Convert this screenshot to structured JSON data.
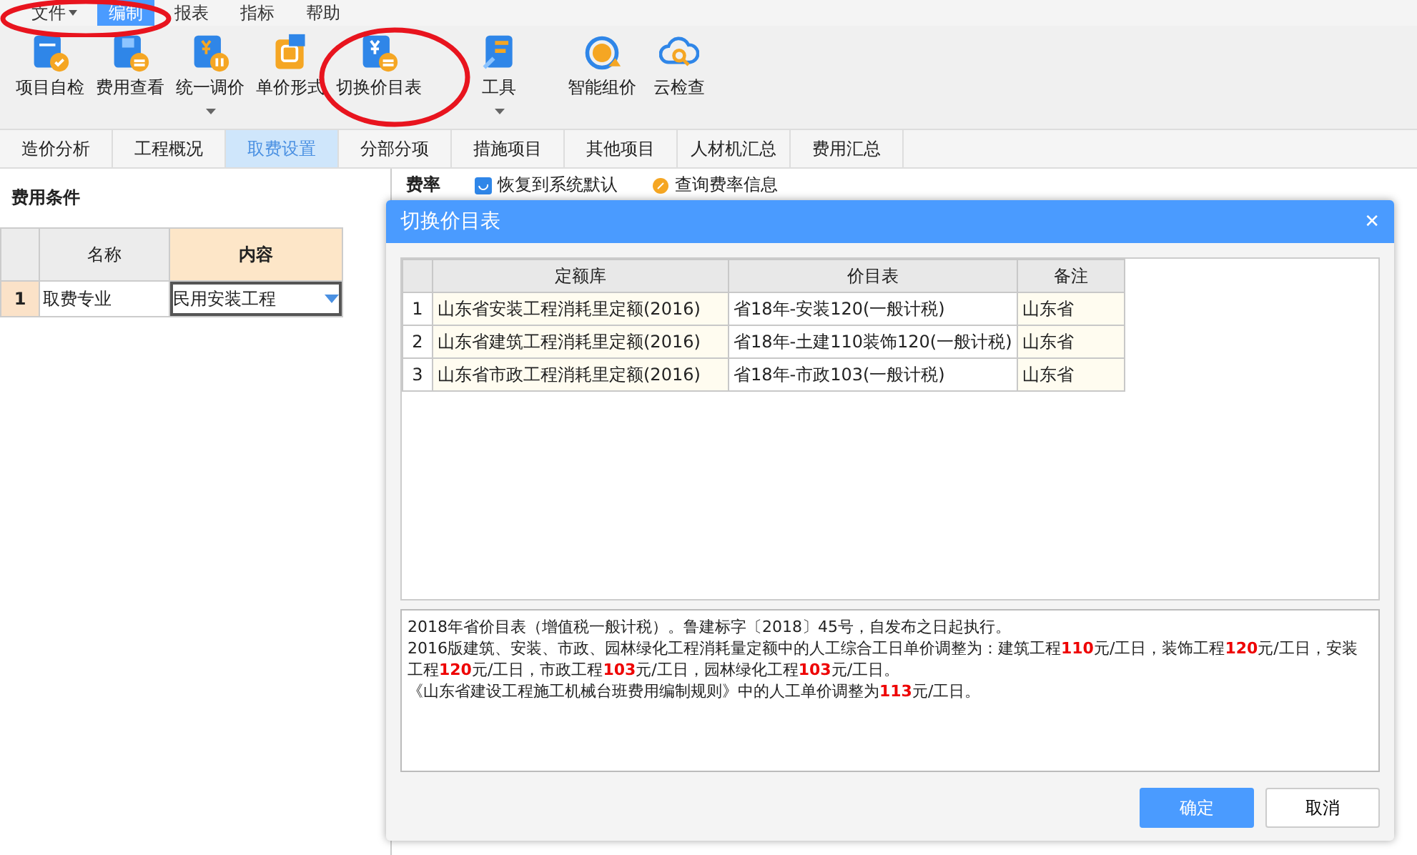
{
  "menu": [
    {
      "label": "文件",
      "selected": false,
      "dropdown": true
    },
    {
      "label": "编制",
      "selected": true,
      "dropdown": false
    },
    {
      "label": "报表",
      "selected": false,
      "dropdown": false
    },
    {
      "label": "指标",
      "selected": false,
      "dropdown": false
    },
    {
      "label": "帮助",
      "selected": false,
      "dropdown": false
    }
  ],
  "toolbar": [
    {
      "label": "项目自检",
      "dropdown": false
    },
    {
      "label": "费用查看",
      "dropdown": false
    },
    {
      "label": "统一调价",
      "dropdown": true
    },
    {
      "label": "单价形式",
      "dropdown": false
    },
    {
      "label": "切换价目表",
      "dropdown": false
    },
    {
      "label": "工具",
      "dropdown": true
    },
    {
      "label": "智能组价",
      "dropdown": false
    },
    {
      "label": "云检查",
      "dropdown": false
    }
  ],
  "tabs": [
    {
      "label": "造价分析",
      "selected": false
    },
    {
      "label": "工程概况",
      "selected": false
    },
    {
      "label": "取费设置",
      "selected": true
    },
    {
      "label": "分部分项",
      "selected": false
    },
    {
      "label": "措施项目",
      "selected": false
    },
    {
      "label": "其他项目",
      "selected": false
    },
    {
      "label": "人材机汇总",
      "selected": false
    },
    {
      "label": "费用汇总",
      "selected": false
    }
  ],
  "left_panel": {
    "title": "费用条件",
    "columns": [
      "名称",
      "内容"
    ],
    "rows": [
      {
        "index": "1",
        "name": "取费专业",
        "content": "民用安装工程"
      }
    ]
  },
  "right_panel": {
    "title": "费率",
    "actions": [
      "恢复到系统默认",
      "查询费率信息"
    ]
  },
  "dialog": {
    "title": "切换价目表",
    "close": "✕",
    "columns": [
      "定额库",
      "价目表",
      "备注"
    ],
    "rows": [
      {
        "index": "1",
        "cells": [
          "山东省安装工程消耗里定额(2016)",
          "省18年-安装120(一般计税)",
          "山东省"
        ]
      },
      {
        "index": "2",
        "cells": [
          "山东省建筑工程消耗里定额(2016)",
          "省18年-土建110装饰120(一般计税)",
          "山东省"
        ]
      },
      {
        "index": "3",
        "cells": [
          "山东省市政工程消耗里定额(2016)",
          "省18年-市政103(一般计税)",
          "山东省"
        ]
      }
    ],
    "notes": [
      "2018年省价目表（增值税一般计税）。鲁建标字〔2018〕45号，自发布之日起执行。",
      "2016版建筑、安装、市政、园林绿化工程消耗量定额中的人工综合工日单价调整为：建筑工程**110**元/工日，装饰工程**120**元/工日，安装工程**120**元/工日，市政工程**103**元/工日，园林绿化工程**103**元/工日。",
      "《山东省建设工程施工机械台班费用编制规则》中的人工单价调整为**113**元/工日。"
    ],
    "buttons": [
      "确定",
      "取消"
    ]
  }
}
